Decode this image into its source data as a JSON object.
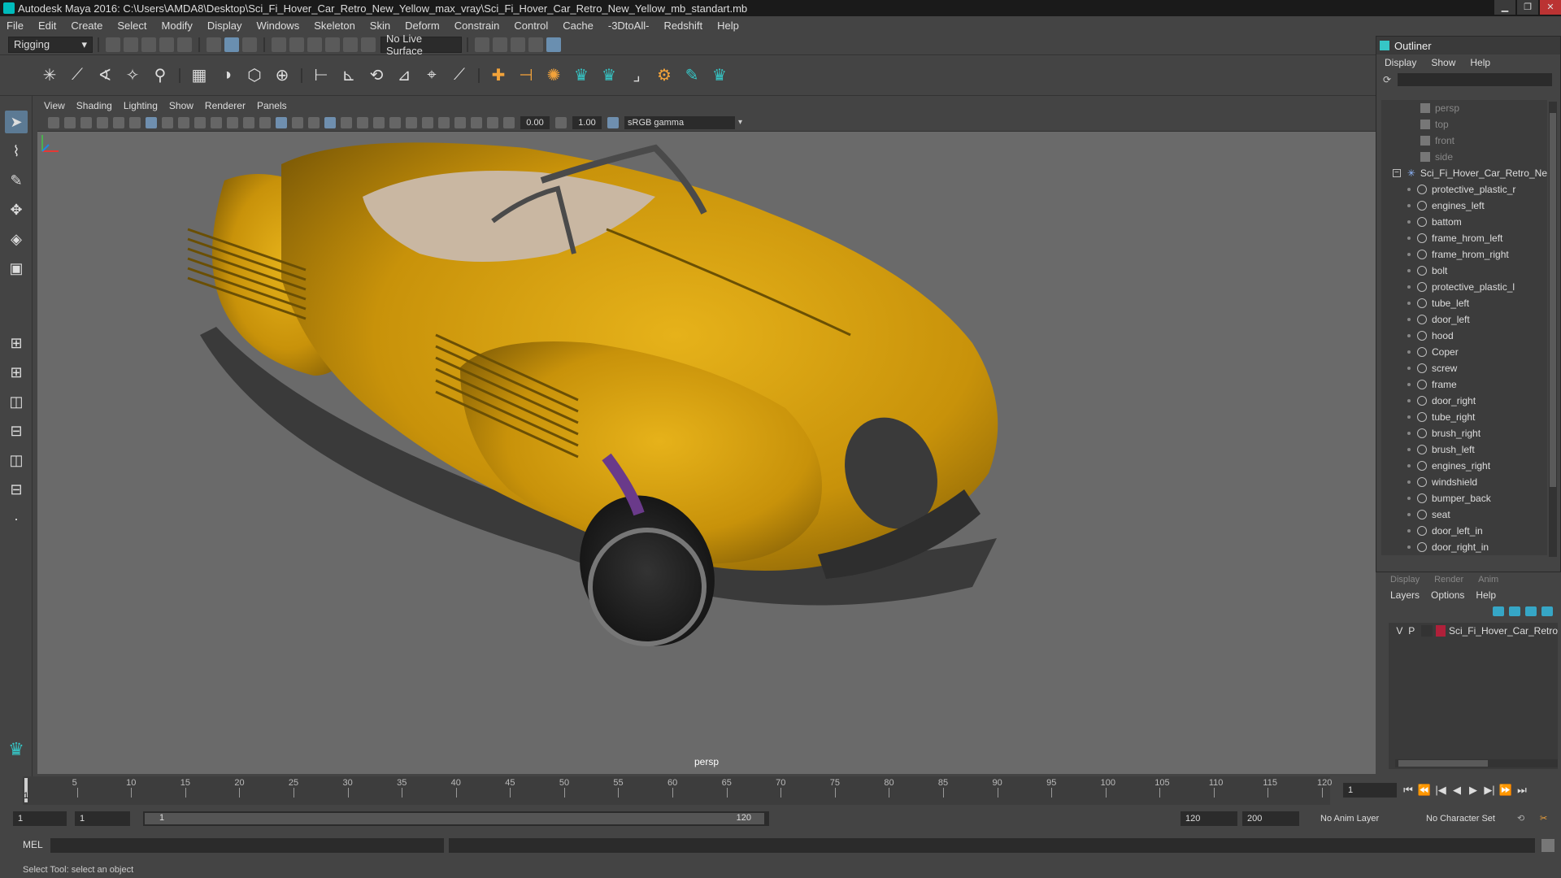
{
  "window": {
    "title": "Autodesk Maya 2016: C:\\Users\\AMDA8\\Desktop\\Sci_Fi_Hover_Car_Retro_New_Yellow_max_vray\\Sci_Fi_Hover_Car_Retro_New_Yellow_mb_standart.mb",
    "minimize": "▁",
    "maximize": "❐",
    "close": "✕"
  },
  "menubar": [
    "File",
    "Edit",
    "Create",
    "Select",
    "Modify",
    "Display",
    "Windows",
    "Skeleton",
    "Skin",
    "Deform",
    "Constrain",
    "Control",
    "Cache",
    "-3DtoAll-",
    "Redshift",
    "Help"
  ],
  "statusline": {
    "menu_set": "Rigging",
    "live_surface": "No Live Surface"
  },
  "panel": {
    "menus": [
      "View",
      "Shading",
      "Lighting",
      "Show",
      "Renderer",
      "Panels"
    ],
    "exposure": "0.00",
    "gamma_value": "1.00",
    "color_space": "sRGB gamma",
    "camera_label": "persp"
  },
  "outliner": {
    "title": "Outliner",
    "menus": [
      "Display",
      "Show",
      "Help"
    ],
    "cameras": [
      "persp",
      "top",
      "front",
      "side"
    ],
    "group": "Sci_Fi_Hover_Car_Retro_Ne",
    "children": [
      "protective_plastic_r",
      "engines_left",
      "battom",
      "frame_hrom_left",
      "frame_hrom_right",
      "bolt",
      "protective_plastic_l",
      "tube_left",
      "door_left",
      "hood",
      "Coper",
      "screw",
      "frame",
      "door_right",
      "tube_right",
      "brush_right",
      "brush_left",
      "engines_right",
      "windshield",
      "bumper_back",
      "seat",
      "door_left_in",
      "door_right_in"
    ]
  },
  "layers": {
    "tabs": [
      "Display",
      "Render",
      "Anim"
    ],
    "menus": [
      "Layers",
      "Options",
      "Help"
    ],
    "rows": [
      {
        "v": "V",
        "p": "P",
        "name": "Sci_Fi_Hover_Car_Retro",
        "color": "#b0203a"
      }
    ]
  },
  "timeline": {
    "ticks": [
      5,
      10,
      15,
      20,
      25,
      30,
      35,
      40,
      45,
      50,
      55,
      60,
      65,
      70,
      75,
      80,
      85,
      90,
      95,
      100,
      105,
      110,
      115,
      120
    ],
    "max_frame": 120,
    "current_frame": "1",
    "current_frame_field": "1"
  },
  "range": {
    "start": "1",
    "start_inner": "1",
    "range_start_label": "1",
    "range_end_label": "120",
    "end": "120",
    "end_total": "200",
    "anim_layer": "No Anim Layer",
    "char_set": "No Character Set"
  },
  "playback": [
    "⏮",
    "⏪",
    "|◀",
    "◀",
    "▶",
    "▶|",
    "⏩",
    "⏭"
  ],
  "cmdline": {
    "label": "MEL"
  },
  "helpline": "Select Tool: select an object",
  "colors": {
    "car_body": "#c8920a",
    "viewport_bg": "#6a6a6a",
    "accent": "#36c6c6"
  }
}
